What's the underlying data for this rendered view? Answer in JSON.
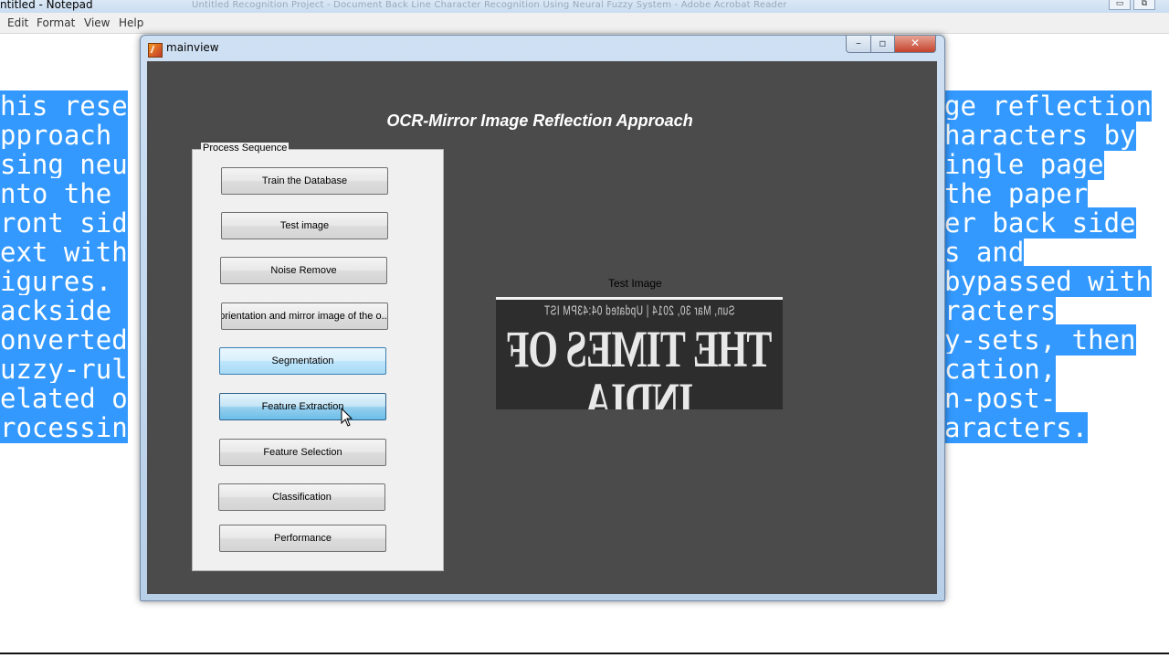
{
  "notepad": {
    "title": "ntitled - Notepad",
    "blurred_taskbar_text": "Untitled Recognition Project - Document Back Line Character Recognition Using Neural Fuzzy System - Adobe Acrobat Reader",
    "menus": [
      "Edit",
      "Format",
      "View",
      "Help"
    ],
    "left_lines": [
      "his rese",
      "pproach ",
      "sing neu",
      "nto the ",
      "ront sid",
      "ext with",
      "igures. ",
      "ackside ",
      "onverted",
      "uzzy-rul",
      "elated o",
      "rocessin"
    ],
    "right_lines": [
      "ge reflection",
      "haracters by",
      "ingle page",
      "the paper",
      "er back side",
      "s and",
      "bypassed with",
      "racters",
      "y-sets, then",
      "cation,",
      "n-post-",
      "aracters."
    ]
  },
  "figure": {
    "window_title": "mainview",
    "header": "OCR-Mirror Image Reflection Approach",
    "panel_title": "Process Sequence",
    "buttons": [
      {
        "label": "Train the Database",
        "state": "normal"
      },
      {
        "label": "Test image",
        "state": "normal"
      },
      {
        "label": "Noise Remove",
        "state": "normal"
      },
      {
        "label": "orientation and mirror image of the o...",
        "state": "normal"
      },
      {
        "label": "Segmentation",
        "state": "hover"
      },
      {
        "label": "Feature Extraction",
        "state": "focused"
      },
      {
        "label": "Feature Selection",
        "state": "normal"
      },
      {
        "label": "Classification",
        "state": "normal"
      },
      {
        "label": "Performance",
        "state": "normal"
      }
    ],
    "axes_title": "Test Image",
    "image": {
      "headline": "THE TIMES OF INDIA",
      "subline": "Sun, Mar 30, 2014 | Updated 04:43PM IST"
    }
  },
  "colors": {
    "selection": "#3399ff",
    "figure_background": "#4b4b4b",
    "panel_background": "#f0f0f0",
    "close_button": "#c4432c"
  }
}
